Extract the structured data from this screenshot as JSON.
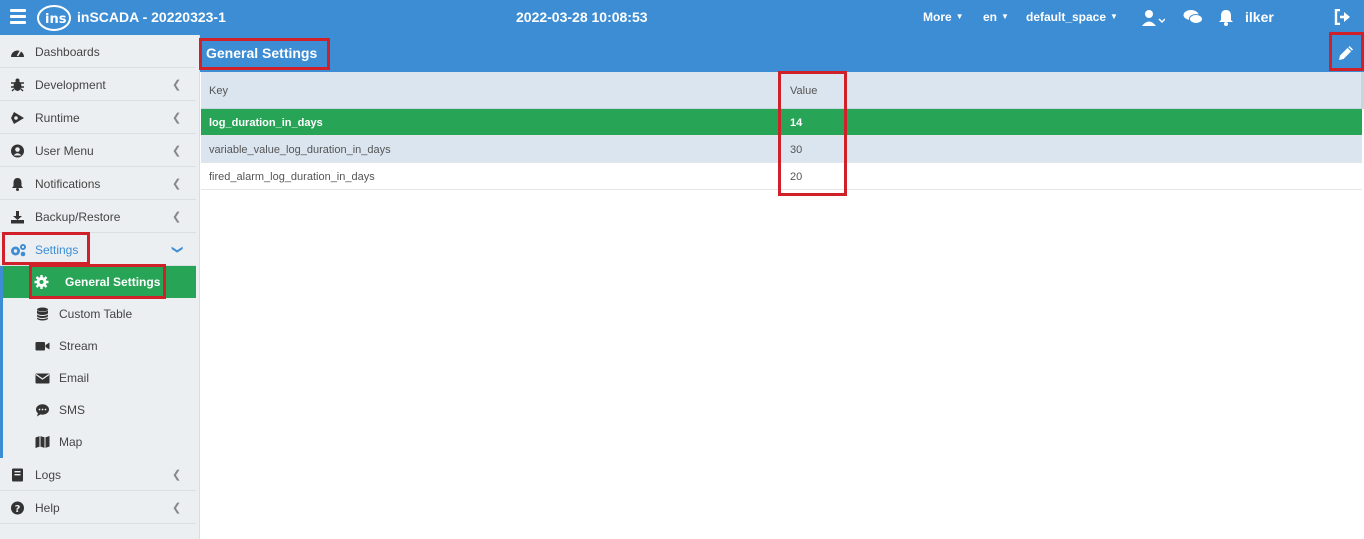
{
  "header": {
    "app_title": "inSCADA - 20220323-1",
    "clock": "2022-03-28 10:08:53",
    "more_label": "More",
    "language": "en",
    "space": "default_space",
    "user_name": "ilker"
  },
  "sidebar": {
    "items": [
      {
        "label": "Dashboards",
        "icon": "dashboard-icon"
      },
      {
        "label": "Development",
        "icon": "bug-icon"
      },
      {
        "label": "Runtime",
        "icon": "play-icon"
      },
      {
        "label": "User Menu",
        "icon": "user-circle-icon"
      },
      {
        "label": "Notifications",
        "icon": "bell-icon"
      },
      {
        "label": "Backup/Restore",
        "icon": "download-icon"
      },
      {
        "label": "Settings",
        "icon": "cogs-icon"
      },
      {
        "label": "Logs",
        "icon": "book-icon"
      },
      {
        "label": "Help",
        "icon": "question-circle-icon"
      }
    ],
    "settings_sub": [
      {
        "label": "General Settings",
        "icon": "gear-icon"
      },
      {
        "label": "Custom Table",
        "icon": "database-icon"
      },
      {
        "label": "Stream",
        "icon": "video-icon"
      },
      {
        "label": "Email",
        "icon": "envelope-icon"
      },
      {
        "label": "SMS",
        "icon": "sms-bubble-icon"
      },
      {
        "label": "Map",
        "icon": "map-icon"
      }
    ]
  },
  "main": {
    "title": "General Settings",
    "columns": [
      "Key",
      "Value"
    ],
    "rows": [
      {
        "key": "log_duration_in_days",
        "value": "14"
      },
      {
        "key": "variable_value_log_duration_in_days",
        "value": "30"
      },
      {
        "key": "fired_alarm_log_duration_in_days",
        "value": "20"
      }
    ]
  },
  "colors": {
    "primary": "#3c8dd4",
    "selected": "#27a456",
    "highlight": "#d0202a"
  }
}
